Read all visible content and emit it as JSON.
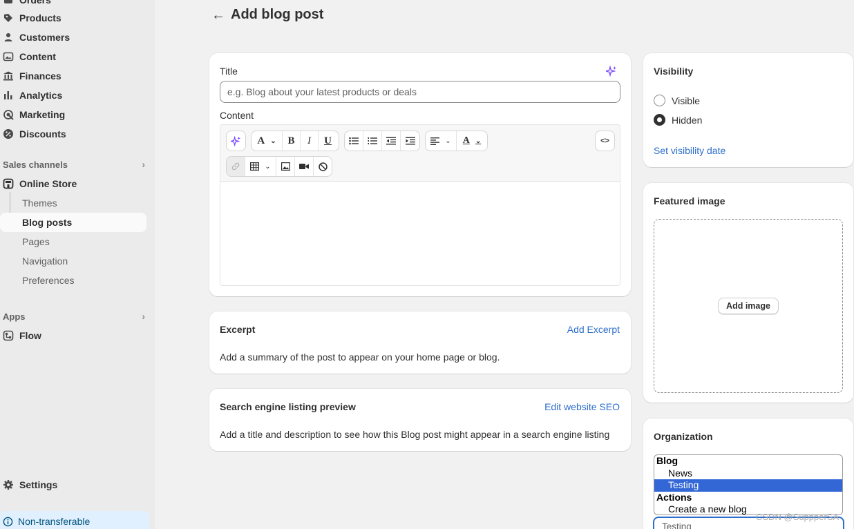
{
  "sidebar": {
    "items": [
      {
        "label": "Orders",
        "icon": "orders-icon"
      },
      {
        "label": "Products",
        "icon": "tag-icon"
      },
      {
        "label": "Customers",
        "icon": "person-icon"
      },
      {
        "label": "Content",
        "icon": "image-icon"
      },
      {
        "label": "Finances",
        "icon": "bank-icon"
      },
      {
        "label": "Analytics",
        "icon": "bar-chart-icon"
      },
      {
        "label": "Marketing",
        "icon": "target-icon"
      },
      {
        "label": "Discounts",
        "icon": "discount-icon"
      }
    ],
    "sales_channels_label": "Sales channels",
    "online_store": "Online Store",
    "store_sub": [
      "Themes",
      "Blog posts",
      "Pages",
      "Navigation",
      "Preferences"
    ],
    "active_sub": "Blog posts",
    "apps_label": "Apps",
    "flow": "Flow",
    "settings": "Settings",
    "non_transferable": "Non-transferable"
  },
  "header": {
    "title": "Add blog post"
  },
  "main": {
    "title_label": "Title",
    "title_placeholder": "e.g. Blog about your latest products or deals",
    "content_label": "Content",
    "code_label": "<>",
    "excerpt": {
      "title": "Excerpt",
      "action": "Add Excerpt",
      "body": "Add a summary of the post to appear on your home page or blog."
    },
    "seo": {
      "title": "Search engine listing preview",
      "action": "Edit website SEO",
      "body": "Add a title and description to see how this Blog post might appear in a search engine listing"
    }
  },
  "visibility": {
    "title": "Visibility",
    "options": [
      "Visible",
      "Hidden"
    ],
    "selected": "Hidden",
    "date_link": "Set visibility date"
  },
  "featured_image": {
    "title": "Featured image",
    "button": "Add image"
  },
  "organization": {
    "title": "Organization",
    "dropdown": {
      "groups": [
        {
          "label": "Blog",
          "options": [
            "News",
            "Testing"
          ]
        },
        {
          "label": "Actions",
          "options": [
            "Create a new blog"
          ]
        }
      ],
      "highlighted": "Testing"
    },
    "select_value": "Testing"
  },
  "watermark": "CSDN @SuppperSA",
  "colors": {
    "accent": "#2c6ecb",
    "ai": "#8051ff",
    "highlight": "#3367d6",
    "banner": "#e0f0ff"
  }
}
